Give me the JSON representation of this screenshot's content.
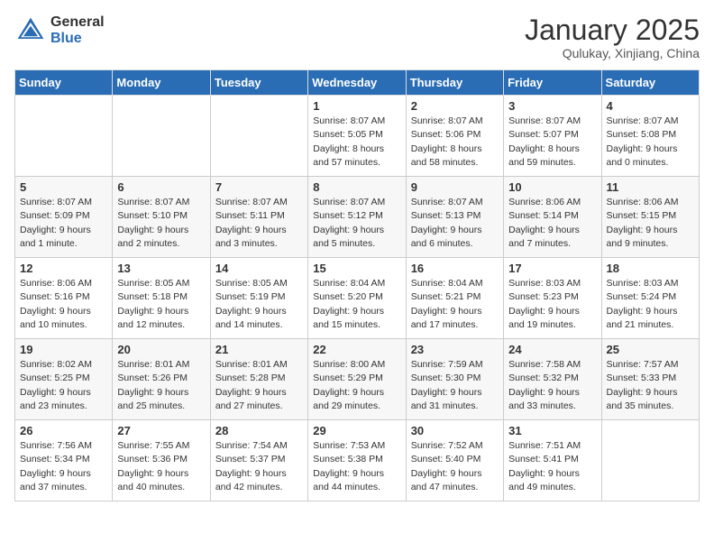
{
  "header": {
    "logo_general": "General",
    "logo_blue": "Blue",
    "month": "January 2025",
    "location": "Qulukay, Xinjiang, China"
  },
  "weekdays": [
    "Sunday",
    "Monday",
    "Tuesday",
    "Wednesday",
    "Thursday",
    "Friday",
    "Saturday"
  ],
  "weeks": [
    [
      {
        "day": "",
        "info": ""
      },
      {
        "day": "",
        "info": ""
      },
      {
        "day": "",
        "info": ""
      },
      {
        "day": "1",
        "info": "Sunrise: 8:07 AM\nSunset: 5:05 PM\nDaylight: 8 hours and 57 minutes."
      },
      {
        "day": "2",
        "info": "Sunrise: 8:07 AM\nSunset: 5:06 PM\nDaylight: 8 hours and 58 minutes."
      },
      {
        "day": "3",
        "info": "Sunrise: 8:07 AM\nSunset: 5:07 PM\nDaylight: 8 hours and 59 minutes."
      },
      {
        "day": "4",
        "info": "Sunrise: 8:07 AM\nSunset: 5:08 PM\nDaylight: 9 hours and 0 minutes."
      }
    ],
    [
      {
        "day": "5",
        "info": "Sunrise: 8:07 AM\nSunset: 5:09 PM\nDaylight: 9 hours and 1 minute."
      },
      {
        "day": "6",
        "info": "Sunrise: 8:07 AM\nSunset: 5:10 PM\nDaylight: 9 hours and 2 minutes."
      },
      {
        "day": "7",
        "info": "Sunrise: 8:07 AM\nSunset: 5:11 PM\nDaylight: 9 hours and 3 minutes."
      },
      {
        "day": "8",
        "info": "Sunrise: 8:07 AM\nSunset: 5:12 PM\nDaylight: 9 hours and 5 minutes."
      },
      {
        "day": "9",
        "info": "Sunrise: 8:07 AM\nSunset: 5:13 PM\nDaylight: 9 hours and 6 minutes."
      },
      {
        "day": "10",
        "info": "Sunrise: 8:06 AM\nSunset: 5:14 PM\nDaylight: 9 hours and 7 minutes."
      },
      {
        "day": "11",
        "info": "Sunrise: 8:06 AM\nSunset: 5:15 PM\nDaylight: 9 hours and 9 minutes."
      }
    ],
    [
      {
        "day": "12",
        "info": "Sunrise: 8:06 AM\nSunset: 5:16 PM\nDaylight: 9 hours and 10 minutes."
      },
      {
        "day": "13",
        "info": "Sunrise: 8:05 AM\nSunset: 5:18 PM\nDaylight: 9 hours and 12 minutes."
      },
      {
        "day": "14",
        "info": "Sunrise: 8:05 AM\nSunset: 5:19 PM\nDaylight: 9 hours and 14 minutes."
      },
      {
        "day": "15",
        "info": "Sunrise: 8:04 AM\nSunset: 5:20 PM\nDaylight: 9 hours and 15 minutes."
      },
      {
        "day": "16",
        "info": "Sunrise: 8:04 AM\nSunset: 5:21 PM\nDaylight: 9 hours and 17 minutes."
      },
      {
        "day": "17",
        "info": "Sunrise: 8:03 AM\nSunset: 5:23 PM\nDaylight: 9 hours and 19 minutes."
      },
      {
        "day": "18",
        "info": "Sunrise: 8:03 AM\nSunset: 5:24 PM\nDaylight: 9 hours and 21 minutes."
      }
    ],
    [
      {
        "day": "19",
        "info": "Sunrise: 8:02 AM\nSunset: 5:25 PM\nDaylight: 9 hours and 23 minutes."
      },
      {
        "day": "20",
        "info": "Sunrise: 8:01 AM\nSunset: 5:26 PM\nDaylight: 9 hours and 25 minutes."
      },
      {
        "day": "21",
        "info": "Sunrise: 8:01 AM\nSunset: 5:28 PM\nDaylight: 9 hours and 27 minutes."
      },
      {
        "day": "22",
        "info": "Sunrise: 8:00 AM\nSunset: 5:29 PM\nDaylight: 9 hours and 29 minutes."
      },
      {
        "day": "23",
        "info": "Sunrise: 7:59 AM\nSunset: 5:30 PM\nDaylight: 9 hours and 31 minutes."
      },
      {
        "day": "24",
        "info": "Sunrise: 7:58 AM\nSunset: 5:32 PM\nDaylight: 9 hours and 33 minutes."
      },
      {
        "day": "25",
        "info": "Sunrise: 7:57 AM\nSunset: 5:33 PM\nDaylight: 9 hours and 35 minutes."
      }
    ],
    [
      {
        "day": "26",
        "info": "Sunrise: 7:56 AM\nSunset: 5:34 PM\nDaylight: 9 hours and 37 minutes."
      },
      {
        "day": "27",
        "info": "Sunrise: 7:55 AM\nSunset: 5:36 PM\nDaylight: 9 hours and 40 minutes."
      },
      {
        "day": "28",
        "info": "Sunrise: 7:54 AM\nSunset: 5:37 PM\nDaylight: 9 hours and 42 minutes."
      },
      {
        "day": "29",
        "info": "Sunrise: 7:53 AM\nSunset: 5:38 PM\nDaylight: 9 hours and 44 minutes."
      },
      {
        "day": "30",
        "info": "Sunrise: 7:52 AM\nSunset: 5:40 PM\nDaylight: 9 hours and 47 minutes."
      },
      {
        "day": "31",
        "info": "Sunrise: 7:51 AM\nSunset: 5:41 PM\nDaylight: 9 hours and 49 minutes."
      },
      {
        "day": "",
        "info": ""
      }
    ]
  ]
}
